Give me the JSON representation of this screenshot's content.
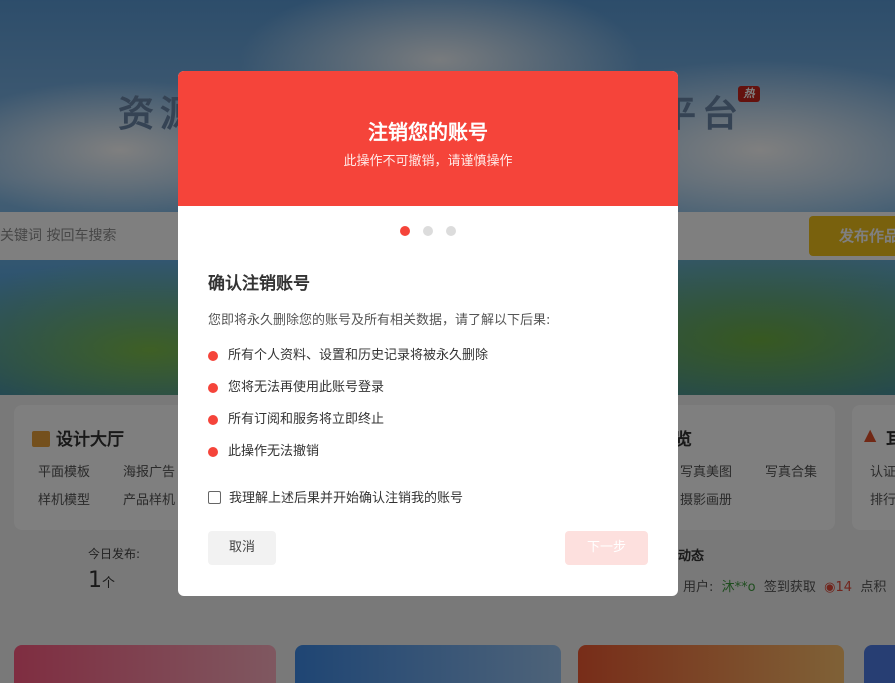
{
  "page": {
    "hero_title_left": "资源",
    "hero_title_right": "平台",
    "hot_tag": "热",
    "search_placeholder": "关键词 按回车搜索",
    "publish_button": "发布作品",
    "design_hall": {
      "title": "设计大厅",
      "links": [
        "平面模板",
        "海报广告",
        "样机模型",
        "产品样机"
      ]
    },
    "photo_card": {
      "title_fragment": "览",
      "links": [
        "写真美图",
        "写真合集",
        "摄影画册"
      ]
    },
    "third_card": {
      "title_fragment": "耳",
      "links": [
        "认证",
        "排行"
      ]
    },
    "today_label": "今日发布:",
    "today_count": "1",
    "today_unit": "个",
    "news_title": "动态",
    "news_prefix": "用户:",
    "news_user": "沐**o",
    "news_action": "签到获取",
    "news_coin": "14",
    "news_suffix": "点积"
  },
  "modal": {
    "title": "注销您的账号",
    "subtitle": "此操作不可撤销，请谨慎操作",
    "steps_total": 3,
    "current_step": 1,
    "section_title": "确认注销账号",
    "intro": "您即将永久删除您的账号及所有相关数据，请了解以下后果:",
    "consequences": [
      "所有个人资料、设置和历史记录将被永久删除",
      "您将无法再使用此账号登录",
      "所有订阅和服务将立即终止",
      "此操作无法撤销"
    ],
    "confirm_label": "我理解上述后果并开始确认注销我的账号",
    "confirm_checked": false,
    "cancel_label": "取消",
    "next_label": "下一步"
  },
  "colors": {
    "accent": "#f5443a",
    "next_disabled_bg": "#fde0de",
    "publish": "#f3c21a"
  }
}
